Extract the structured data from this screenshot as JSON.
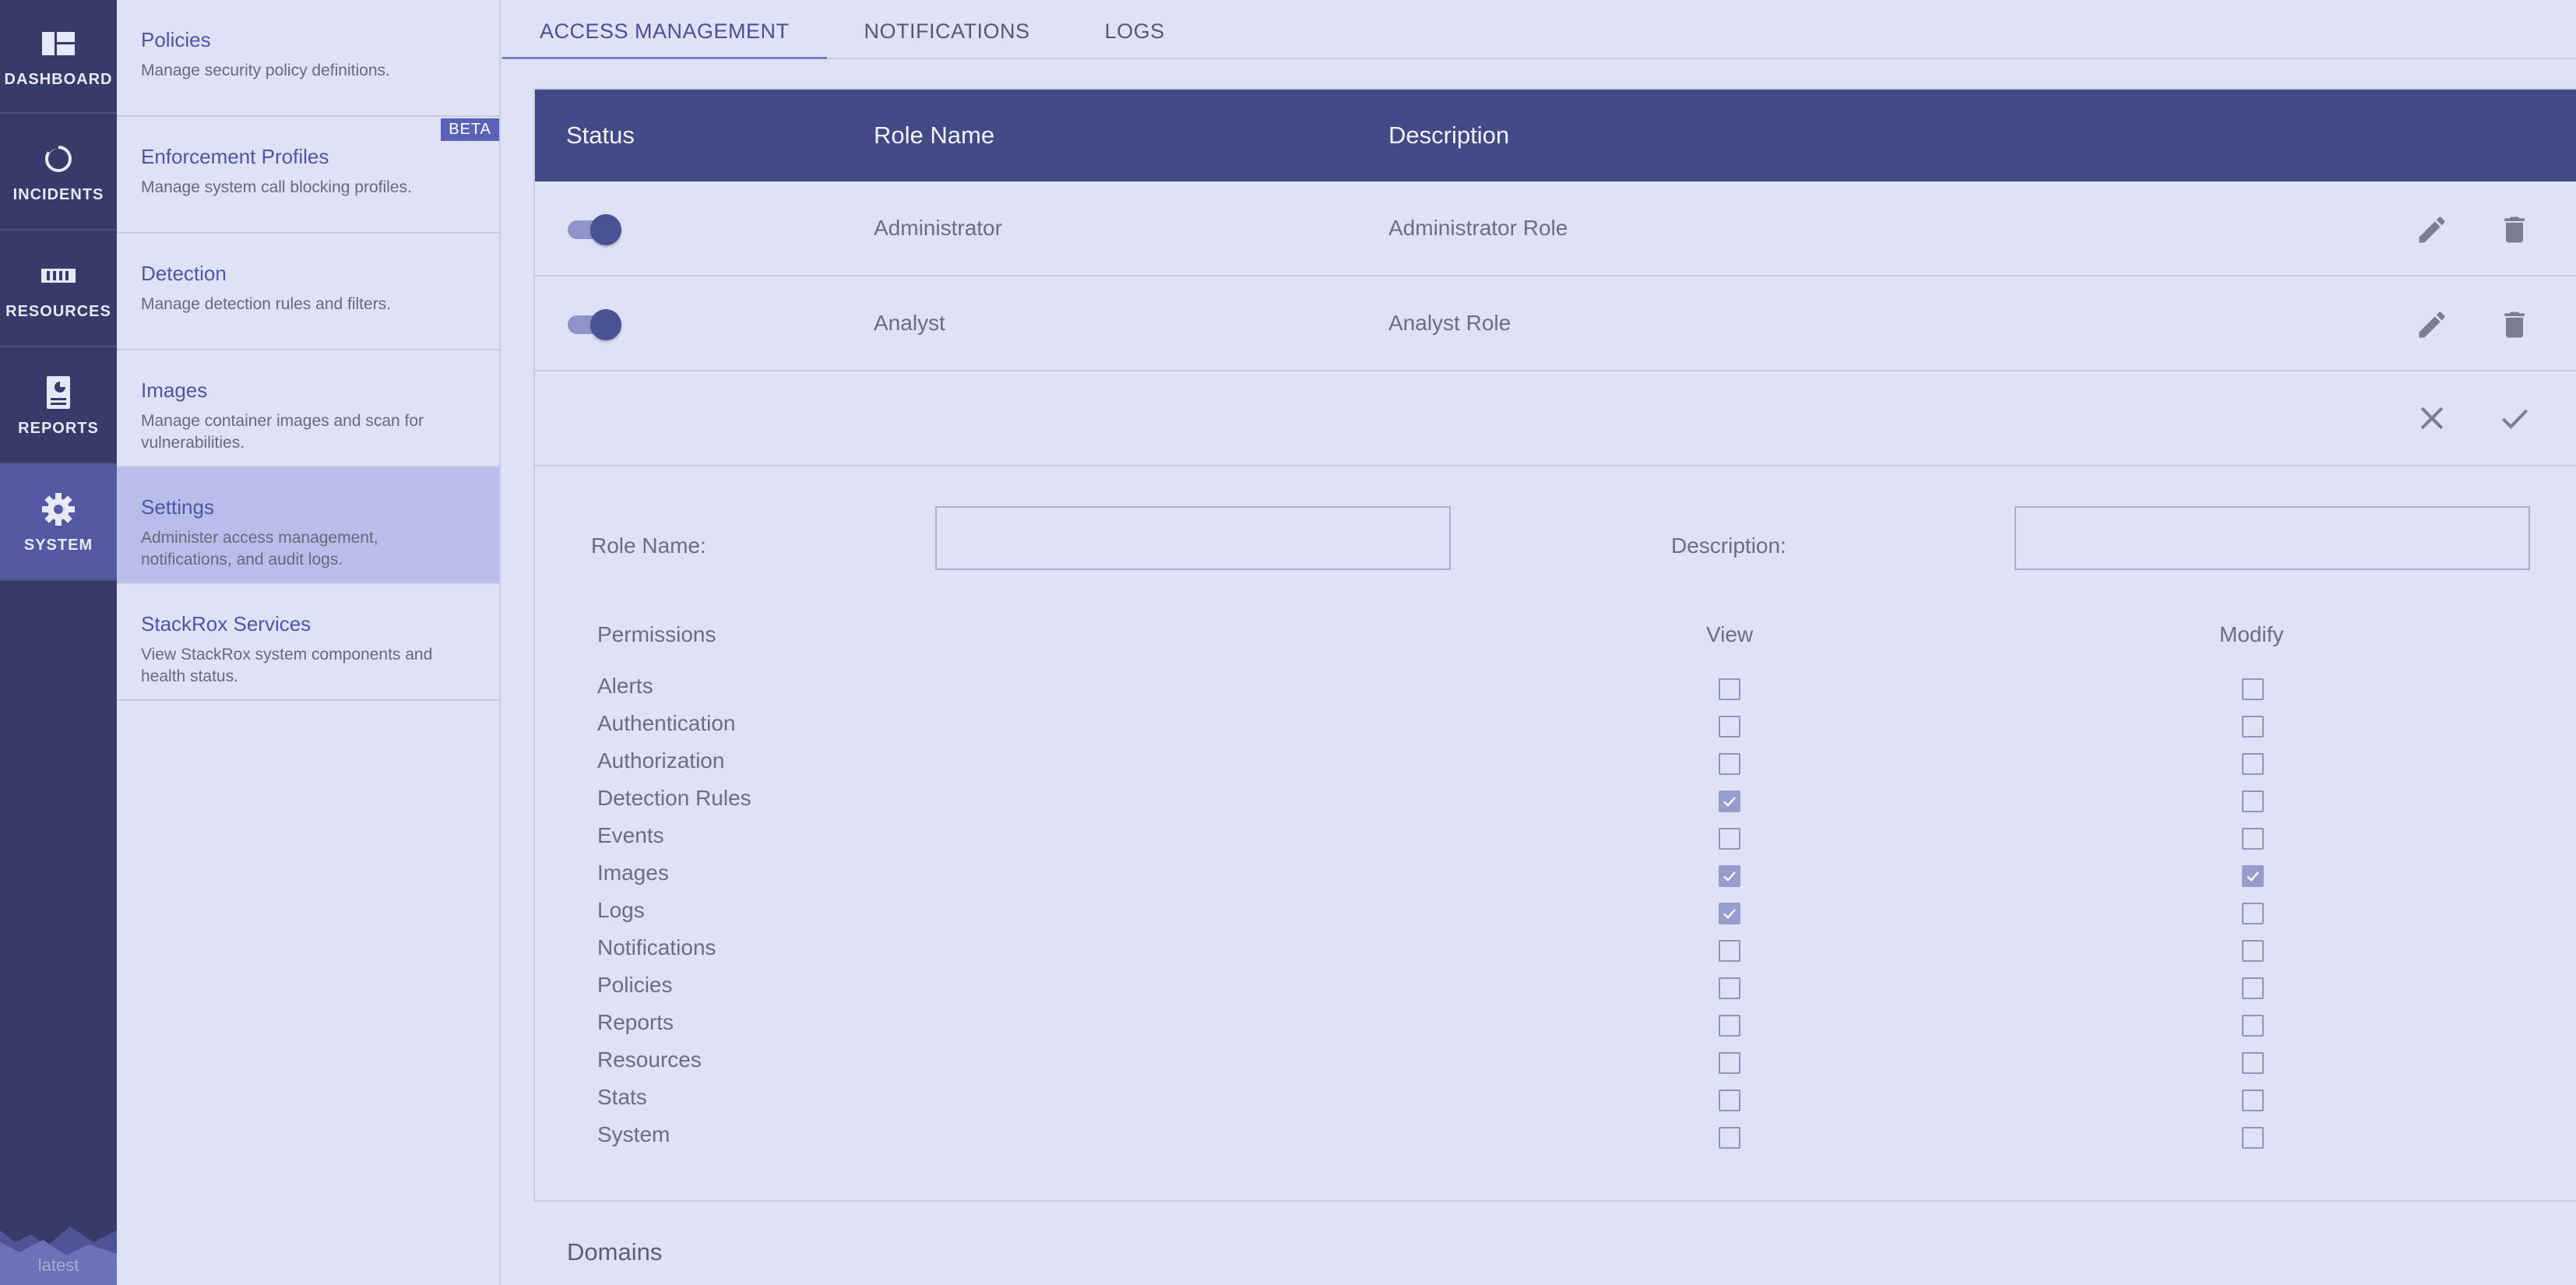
{
  "leftnav": {
    "items": [
      {
        "label": "DASHBOARD",
        "icon": "dashboard-icon"
      },
      {
        "label": "INCIDENTS",
        "icon": "incidents-icon"
      },
      {
        "label": "RESOURCES",
        "icon": "resources-icon"
      },
      {
        "label": "REPORTS",
        "icon": "reports-icon"
      },
      {
        "label": "SYSTEM",
        "icon": "gear-icon",
        "active": true
      }
    ],
    "version": "latest"
  },
  "subnav": {
    "items": [
      {
        "title": "Policies",
        "desc": "Manage security policy definitions."
      },
      {
        "title": "Enforcement Profiles",
        "desc": "Manage system call blocking profiles.",
        "badge": "BETA"
      },
      {
        "title": "Detection",
        "desc": "Manage detection rules and filters."
      },
      {
        "title": "Images",
        "desc": "Manage container images and scan for vulnerabilities."
      },
      {
        "title": "Settings",
        "desc": "Administer access management, notifications, and audit logs.",
        "active": true
      },
      {
        "title": "StackRox Services",
        "desc": "View StackRox system components and health status."
      }
    ]
  },
  "tabs": [
    "ACCESS MANAGEMENT",
    "NOTIFICATIONS",
    "LOGS"
  ],
  "table": {
    "headers": {
      "status": "Status",
      "role_name": "Role Name",
      "description": "Description"
    },
    "rows": [
      {
        "enabled": true,
        "role_name": "Administrator",
        "description": "Administrator Role"
      },
      {
        "enabled": true,
        "role_name": "Analyst",
        "description": "Analyst Role"
      }
    ]
  },
  "form": {
    "role_name_label": "Role Name:",
    "role_name_value": "",
    "description_label": "Description:",
    "description_value": "",
    "permissions_header": "Permissions",
    "view_header": "View",
    "modify_header": "Modify",
    "permissions": [
      {
        "name": "Alerts",
        "view": false,
        "modify": false
      },
      {
        "name": "Authentication",
        "view": false,
        "modify": false
      },
      {
        "name": "Authorization",
        "view": false,
        "modify": false
      },
      {
        "name": "Detection Rules",
        "view": true,
        "modify": false
      },
      {
        "name": "Events",
        "view": false,
        "modify": false
      },
      {
        "name": "Images",
        "view": true,
        "modify": true
      },
      {
        "name": "Logs",
        "view": true,
        "modify": false
      },
      {
        "name": "Notifications",
        "view": false,
        "modify": false
      },
      {
        "name": "Policies",
        "view": false,
        "modify": false
      },
      {
        "name": "Reports",
        "view": false,
        "modify": false
      },
      {
        "name": "Resources",
        "view": false,
        "modify": false
      },
      {
        "name": "Stats",
        "view": false,
        "modify": false
      },
      {
        "name": "System",
        "view": false,
        "modify": false
      }
    ]
  },
  "domains_label": "Domains",
  "colors": {
    "nav_bg": "#373b69",
    "nav_active": "#535aa3",
    "table_header": "#424a86",
    "accent": "#4e56a7"
  }
}
